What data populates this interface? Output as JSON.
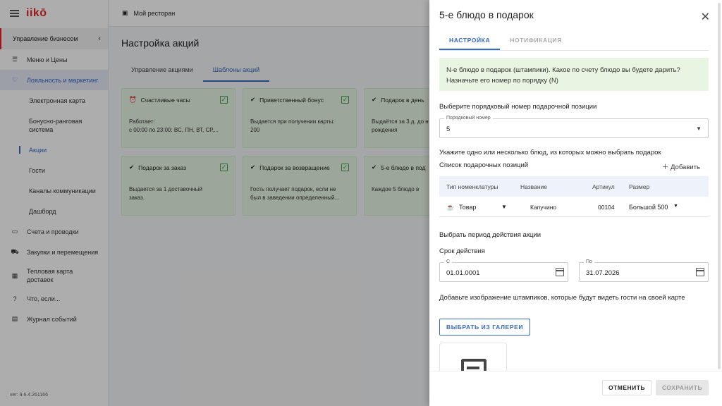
{
  "app": {
    "logo": "iikō",
    "restaurant": "Мой ресторан",
    "version": "ver: 9.6.4.261166"
  },
  "sidebar": {
    "section": "Управление бизнесом",
    "items": [
      {
        "label": "Меню и Цены",
        "icon": "menu-list-icon"
      },
      {
        "label": "Лояльность и маркетинг",
        "icon": "heart-icon"
      },
      {
        "label": "Счета и проводки",
        "icon": "wallet-icon"
      },
      {
        "label": "Закупки и перемещения",
        "icon": "cart-icon"
      },
      {
        "label": "Тепловая карта доставок",
        "icon": "map-icon"
      },
      {
        "label": "Что, если...",
        "icon": "question-icon"
      },
      {
        "label": "Журнал событий",
        "icon": "journal-icon"
      }
    ],
    "subitems": [
      "Электронная карта",
      "Бонусно-ранговая система",
      "Акции",
      "Гости",
      "Каналы коммуникации",
      "Дашборд"
    ]
  },
  "main": {
    "title": "Настройка акций",
    "tabs": [
      "Управление акциями",
      "Шаблоны акций"
    ],
    "cards": [
      {
        "title": "Счастливые часы",
        "body": "Работает:\nс 00:00 по 23:00: ВС, ПН, ВТ, СР,..."
      },
      {
        "title": "Приветственный бонус",
        "body": "Выдается при получении карты:\n200"
      },
      {
        "title": "Подарок в день",
        "body": "Выдаётся за 3 д. до н\nрождения"
      },
      {
        "title": "Подарок за заказ",
        "body": "Выдается за 1 доставочный\nзаказ."
      },
      {
        "title": "Подарок за возвращение",
        "body": "Гость получает подарок, если не\nбыл в заведении определенный..."
      },
      {
        "title": "5-е блюдо в под",
        "body": "Каждое 5 блюдо в"
      }
    ]
  },
  "drawer": {
    "title": "5-е блюдо в подарок",
    "tabs": [
      "НАСТРОЙКА",
      "НОТИФИКАЦИЯ"
    ],
    "info": "N-е блюдо в подарок (штампики). Какое по счету блюдо вы будете дарить? Назначьте его номер по порядку (N)",
    "position_label": "Выберите порядковый номер подарочной позиции",
    "position_field_label": "Порядковый номер",
    "position_value": "5",
    "dishes_label": "Укажите одно или несколько блюд, из которых можно выбрать подарок",
    "list_label": "Список подарочных позиций",
    "add_label": "Добавить",
    "table_headers": [
      "Тип номенклатуры",
      "Название",
      "Артикул",
      "Размер"
    ],
    "row": {
      "type": "Товар",
      "name": "Капучино",
      "article": "00104",
      "size": "Большой 500"
    },
    "period_label": "Выбрать период действия акции",
    "term_label": "Срок действия",
    "from_label": "С",
    "from_value": "01.01.0001",
    "to_label": "По",
    "to_value": "31.07.2026",
    "image_label": "Добавьте изображение штампиков, которые будут видеть гости на своей карте",
    "gallery_button": "ВЫБРАТЬ ИЗ ГАЛЕРЕИ",
    "cancel_button": "ОТМЕНИТЬ",
    "save_button": "СОХРАНИТЬ"
  }
}
